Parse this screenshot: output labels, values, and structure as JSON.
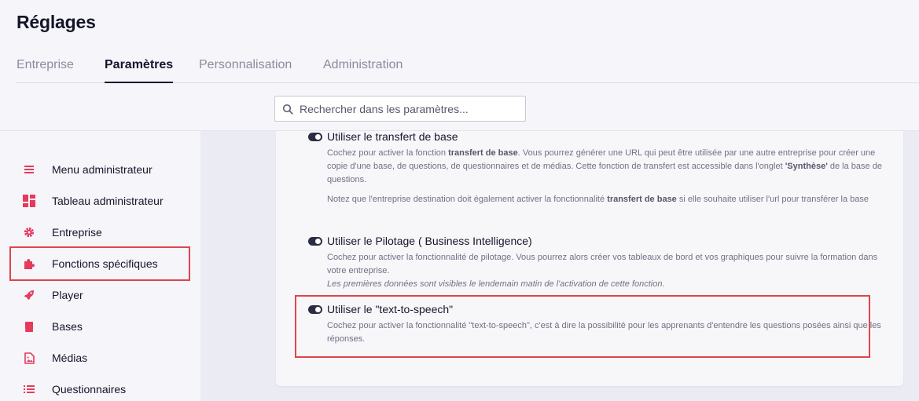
{
  "page": {
    "title": "Réglages"
  },
  "tabs": [
    {
      "label": "Entreprise",
      "active": false
    },
    {
      "label": "Paramètres",
      "active": true
    },
    {
      "label": "Personnalisation",
      "active": false
    },
    {
      "label": "Administration",
      "active": false
    }
  ],
  "search": {
    "placeholder": "Rechercher dans les paramètres..."
  },
  "sidebar": {
    "items": [
      {
        "label": "Menu administrateur",
        "icon": "menu-icon"
      },
      {
        "label": "Tableau administrateur",
        "icon": "dashboard-icon"
      },
      {
        "label": "Entreprise",
        "icon": "gear-icon"
      },
      {
        "label": "Fonctions spécifiques",
        "icon": "puzzle-icon",
        "highlighted": true
      },
      {
        "label": "Player",
        "icon": "rocket-icon"
      },
      {
        "label": "Bases",
        "icon": "book-icon"
      },
      {
        "label": "Médias",
        "icon": "image-icon"
      },
      {
        "label": "Questionnaires",
        "icon": "list-icon"
      }
    ]
  },
  "settings": [
    {
      "title": "Utiliser le transfert de base",
      "enabled": true,
      "desc1_a": "Cochez pour activer la fonction ",
      "desc1_b": "transfert de base",
      "desc1_c": ". Vous pourrez générer une URL qui peut être utilisée par une autre entreprise pour créer une copie d'une base, de questions, de questionnaires et de médias. Cette fonction de transfert est accessible dans l'onglet ",
      "desc1_d": "'Synthèse'",
      "desc1_e": " de la base de questions.",
      "desc2_a": "Notez que l'entreprise destination doit également activer la fonctionnalité ",
      "desc2_b": "transfert de base",
      "desc2_c": " si elle souhaite utiliser l'url pour transférer la base"
    },
    {
      "title": "Utiliser le Pilotage ( Business Intelligence)",
      "enabled": true,
      "desc": "Cochez pour activer la fonctionnalité de pilotage. Vous pourrez alors créer vos tableaux de bord et vos graphiques pour suivre la formation dans votre entreprise.",
      "note": "Les premières données sont visibles le lendemain matin de l'activation de cette fonction."
    },
    {
      "title": "Utiliser le \"text-to-speech\"",
      "enabled": true,
      "desc": "Cochez pour activer la fonctionnalité \"text-to-speech\", c'est à dire la possibilité pour les apprenants d'entendre les questions posées ainsi que les réponses."
    }
  ],
  "colors": {
    "accent": "#e63a5c",
    "highlight": "#e0444c",
    "toggle": "#2a2d44"
  }
}
